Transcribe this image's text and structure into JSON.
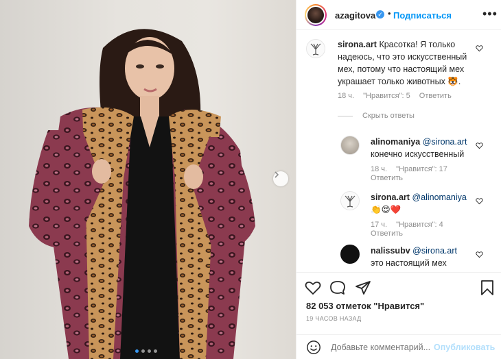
{
  "header": {
    "username": "azagitova",
    "verified_mark": "✓",
    "separator": "•",
    "follow_label": "Подписаться",
    "more_label": "•••"
  },
  "comments": [
    {
      "username": "sirona.art",
      "text": "Красотка! Я только надеюсь, что это искусственный мех, потому что настоящий мех украшает только животных 🐯.",
      "age": "18 ч.",
      "likes": "\"Нравится\": 5",
      "reply": "Ответить",
      "avatar_icon": "tree-icon"
    }
  ],
  "hide_replies_label": "Скрыть ответы",
  "replies": [
    {
      "username": "alinomaniya",
      "mention": "@sirona.art",
      "text": "конечно искусственный",
      "age": "18 ч.",
      "likes": "\"Нравится\": 17",
      "reply": "Ответить"
    },
    {
      "username": "sirona.art",
      "mention": "@alinomaniya",
      "text": "👏😍❤️",
      "age": "17 ч.",
      "likes": "\"Нравится\": 4",
      "reply": "Ответить"
    },
    {
      "username": "nalissubv",
      "mention": "@sirona.art",
      "text": "это настоящий мех"
    }
  ],
  "actions": {
    "likes_count": "82 053 отметок \"Нравится\"",
    "timestamp": "19 ЧАСОВ НАЗАД"
  },
  "add_comment": {
    "placeholder": "Добавьте комментарий...",
    "post_label": "Опубликовать"
  },
  "carousel": {
    "total_dots": 4,
    "active_index": 0
  },
  "colors": {
    "link_blue": "#0095f6",
    "text": "#262626",
    "muted": "#8e8e8e",
    "post_disabled": "#b2dffc"
  }
}
